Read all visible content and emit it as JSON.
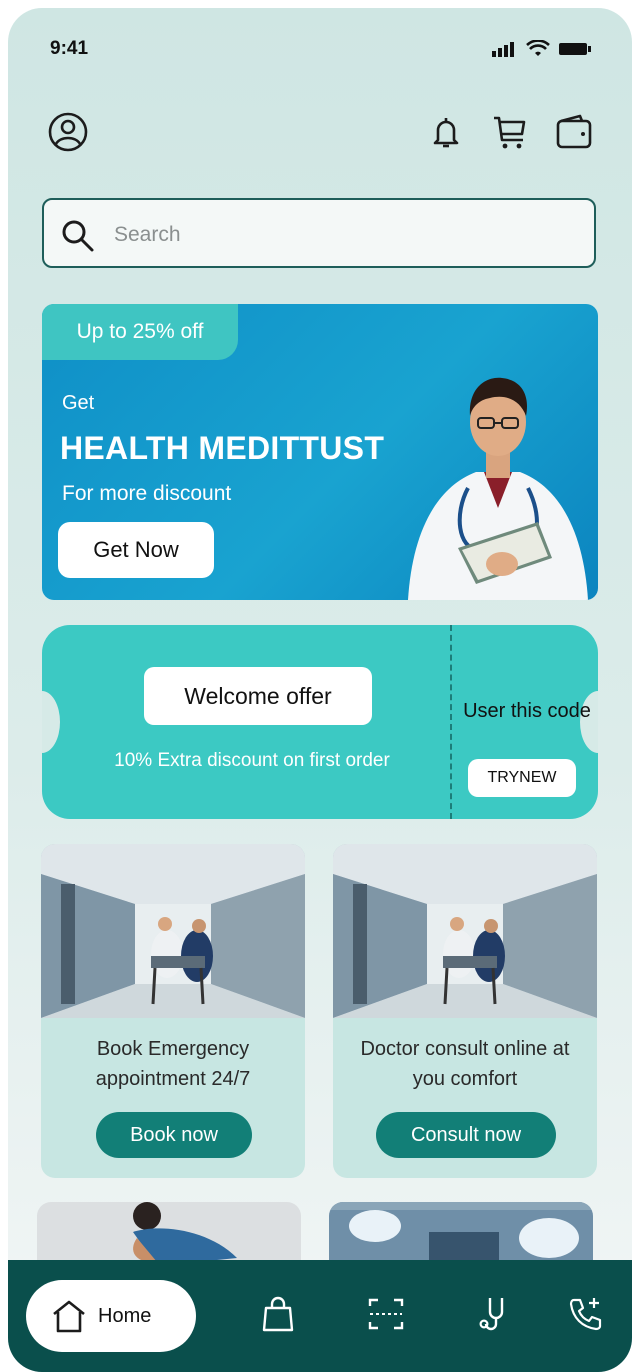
{
  "status_bar": {
    "time": "9:41"
  },
  "header": {
    "profile_icon": "user-circle-icon",
    "bell_icon": "bell-icon",
    "cart_icon": "cart-icon",
    "wallet_icon": "wallet-icon"
  },
  "search": {
    "placeholder": "Search"
  },
  "banner": {
    "badge": "Up to 25% off",
    "pre": "Get",
    "title": "HEALTH MEDITTUST",
    "subtitle": "For more discount",
    "cta": "Get Now"
  },
  "coupon": {
    "welcome": "Welcome  offer",
    "description": "10% Extra discount on first order",
    "use_code": "User this code",
    "code": "TRYNEW"
  },
  "cards": [
    {
      "text": "Book Emergency appointment 24/7",
      "button": "Book now"
    },
    {
      "text": "Doctor consult online at you comfort",
      "button": "Consult now"
    }
  ],
  "bottom_nav": {
    "home_label": "Home",
    "items": [
      "home-icon",
      "shopping-bag-icon",
      "scan-icon",
      "stethoscope-icon",
      "phone-plus-icon"
    ]
  },
  "colors": {
    "accent": "#127f77",
    "nav_bg": "#0a4f4c",
    "coupon": "#3cc9c3",
    "banner": "#19a3d0"
  }
}
